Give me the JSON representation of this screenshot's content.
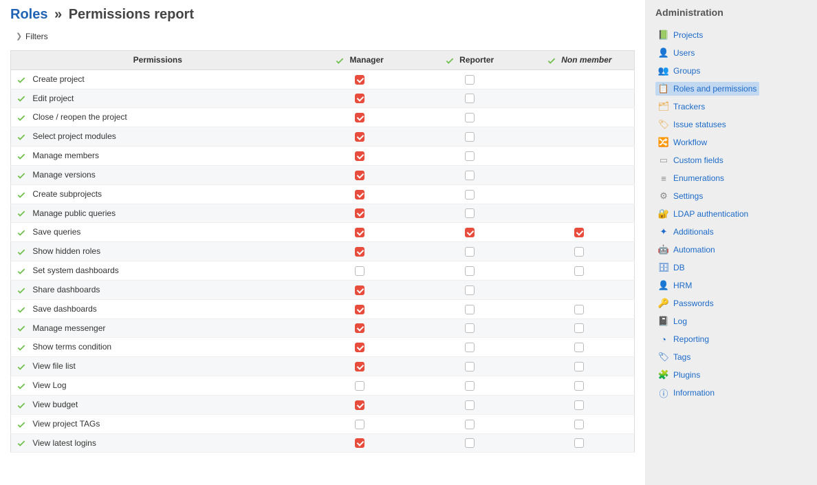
{
  "header": {
    "roles_link": "Roles",
    "sep": "»",
    "page_title": "Permissions report",
    "filters_label": "Filters"
  },
  "table": {
    "head_permissions": "Permissions",
    "roles": [
      "Manager",
      "Reporter",
      "Non member"
    ],
    "rows": [
      {
        "name": "Create project",
        "vals": [
          true,
          false,
          null
        ]
      },
      {
        "name": "Edit project",
        "vals": [
          true,
          false,
          null
        ]
      },
      {
        "name": "Close / reopen the project",
        "vals": [
          true,
          false,
          null
        ]
      },
      {
        "name": "Select project modules",
        "vals": [
          true,
          false,
          null
        ]
      },
      {
        "name": "Manage members",
        "vals": [
          true,
          false,
          null
        ]
      },
      {
        "name": "Manage versions",
        "vals": [
          true,
          false,
          null
        ]
      },
      {
        "name": "Create subprojects",
        "vals": [
          true,
          false,
          null
        ]
      },
      {
        "name": "Manage public queries",
        "vals": [
          true,
          false,
          null
        ]
      },
      {
        "name": "Save queries",
        "vals": [
          true,
          true,
          true
        ]
      },
      {
        "name": "Show hidden roles",
        "vals": [
          true,
          false,
          false
        ]
      },
      {
        "name": "Set system dashboards",
        "vals": [
          false,
          false,
          false
        ]
      },
      {
        "name": "Share dashboards",
        "vals": [
          true,
          false,
          null
        ]
      },
      {
        "name": "Save dashboards",
        "vals": [
          true,
          false,
          false
        ]
      },
      {
        "name": "Manage messenger",
        "vals": [
          true,
          false,
          false
        ]
      },
      {
        "name": "Show terms condition",
        "vals": [
          true,
          false,
          false
        ]
      },
      {
        "name": "View file list",
        "vals": [
          true,
          false,
          false
        ]
      },
      {
        "name": "View Log",
        "vals": [
          false,
          false,
          false
        ]
      },
      {
        "name": "View budget",
        "vals": [
          true,
          false,
          false
        ]
      },
      {
        "name": "View project TAGs",
        "vals": [
          false,
          false,
          false
        ]
      },
      {
        "name": "View latest logins",
        "vals": [
          true,
          false,
          false
        ]
      }
    ]
  },
  "admin": {
    "title": "Administration",
    "items": [
      {
        "label": "Projects",
        "icon": "projects",
        "color": "#6fbf4a"
      },
      {
        "label": "Users",
        "icon": "users",
        "color": "#6fbf4a"
      },
      {
        "label": "Groups",
        "icon": "groups",
        "color": "#4a90d9"
      },
      {
        "label": "Roles and permissions",
        "icon": "roles",
        "color": "#e8a33d",
        "selected": true
      },
      {
        "label": "Trackers",
        "icon": "trackers",
        "color": "#e8a33d"
      },
      {
        "label": "Issue statuses",
        "icon": "statuses",
        "color": "#e8a33d"
      },
      {
        "label": "Workflow",
        "icon": "workflow",
        "color": "#6fbf4a"
      },
      {
        "label": "Custom fields",
        "icon": "custom-fields",
        "color": "#999"
      },
      {
        "label": "Enumerations",
        "icon": "enumerations",
        "color": "#888"
      },
      {
        "label": "Settings",
        "icon": "settings",
        "color": "#888"
      },
      {
        "label": "LDAP authentication",
        "icon": "ldap",
        "color": "#888"
      },
      {
        "label": "Additionals",
        "icon": "additionals",
        "color": "#1b6ac9"
      },
      {
        "label": "Automation",
        "icon": "automation",
        "color": "#1b6ac9"
      },
      {
        "label": "DB",
        "icon": "db",
        "color": "#1b6ac9"
      },
      {
        "label": "HRM",
        "icon": "hrm",
        "color": "#1b6ac9"
      },
      {
        "label": "Passwords",
        "icon": "passwords",
        "color": "#1b6ac9"
      },
      {
        "label": "Log",
        "icon": "log",
        "color": "#1b6ac9"
      },
      {
        "label": "Reporting",
        "icon": "reporting",
        "color": "#1b6ac9"
      },
      {
        "label": "Tags",
        "icon": "tags",
        "color": "#1b6ac9"
      },
      {
        "label": "Plugins",
        "icon": "plugins",
        "color": "#6fbf4a"
      },
      {
        "label": "Information",
        "icon": "information",
        "color": "#1b6ac9"
      }
    ]
  }
}
